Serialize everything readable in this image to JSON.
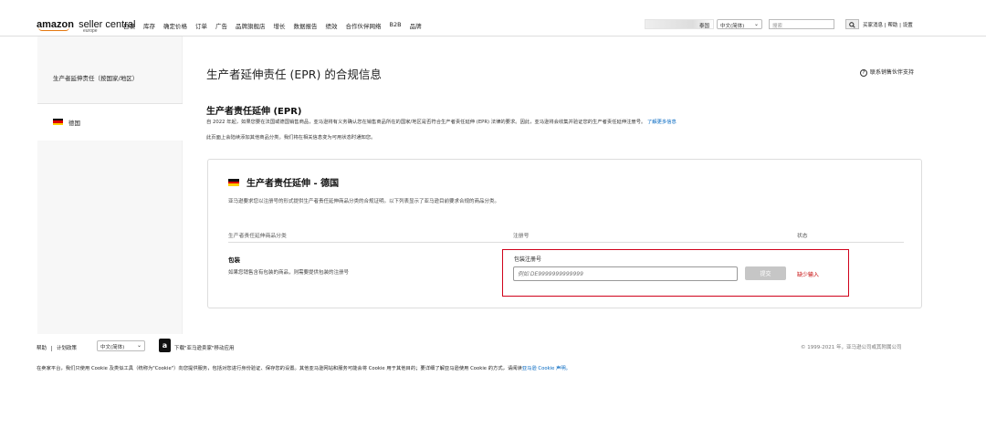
{
  "header": {
    "logo": {
      "brand": "amazon",
      "product": "seller central",
      "region": "europe"
    },
    "nav": [
      "目录",
      "库存",
      "确定价格",
      "订单",
      "广告",
      "品牌旗舰店",
      "增长",
      "数据报告",
      "绩效",
      "合作伙伴网络",
      "B2B",
      "品牌"
    ],
    "account_label": "泰国",
    "language": "中文(简体)",
    "search_placeholder": "搜索",
    "links": "买家消息 | 帮助 | 设置"
  },
  "sidebar": {
    "title": "生产者延伸责任（按国家/地区）",
    "items": [
      {
        "label": "德国"
      }
    ]
  },
  "main": {
    "page_title": "生产者延伸责任 (EPR) 的合规信息",
    "support_link": "联系销售伙伴支持",
    "section_title": "生产者责任延伸 (EPR)",
    "section_desc": "自 2022 年起，如果您要在法国或德国销售商品，亚马逊将有义务确认您在销售商品所在的国家/地区是否符合生产者责任延伸 (EPR) 法律的要求。因此，亚马逊将会收集并验证您的生产者责任延伸注册号。",
    "learn_more": "了解更多信息",
    "section_note": "此页面上会陆续添加其他商品分类。我们将在相关信息变为可用状态时通知您。",
    "card": {
      "title": "生产者责任延伸 - 德国",
      "desc": "亚马逊要求您以注册号的形式提供生产者责任延伸商品分类的合规证明。以下列表显示了亚马逊目前要求合规的商品分类。",
      "col_category": "生产者责任延伸商品分类",
      "col_reg": "注册号",
      "col_status": "状态",
      "row": {
        "category": "包装",
        "category_desc": "如果您销售含有包装的商品，则需要提供包装的注册号",
        "field_label": "包装注册号",
        "placeholder": "例如 DE9999999999999",
        "submit": "提交",
        "status": "缺少输入"
      }
    }
  },
  "footer": {
    "help": "帮助",
    "policy": "计划政策",
    "language": "中文(简体)",
    "app_link": "下载\"亚马逊卖家\"移动应用",
    "copyright": "© 1999-2021 年，亚马逊公司或其附属公司",
    "cookie_text": "在卖家平台，我们只使用 Cookie 及类似工具（统称为\"Cookie\"）向您提供服务，包括对您进行身份验证、保存您的设置。其他亚马逊网站和服务可能会将 Cookie 用于其他目的；要详细了解亚马逊使用 Cookie 的方式，请阅读",
    "cookie_link": "亚马逊 Cookie 声明。"
  },
  "colors": {
    "accent": "#e47911",
    "link": "#0066c0",
    "error": "#d0021b"
  }
}
